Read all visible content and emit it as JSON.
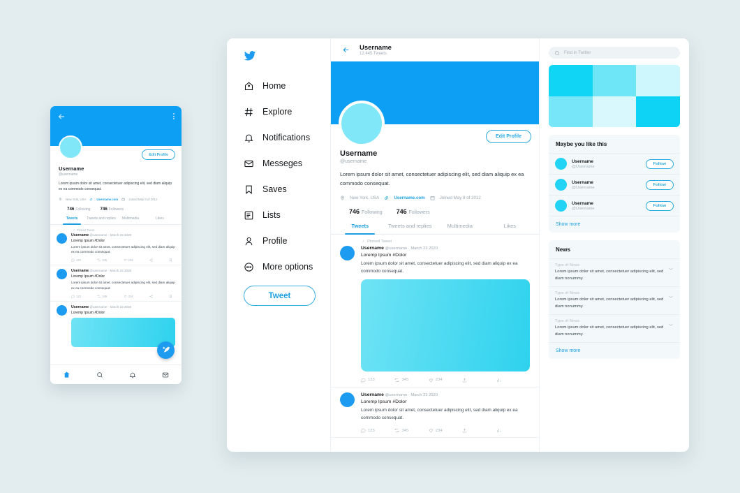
{
  "theme": {
    "background": "#e3ecee",
    "brand_blue": "#1d9bf0",
    "banner_blue": "#0d9ff4",
    "accent_cyan": "#23d3f5",
    "avatar_cyan": "#7fe7f7",
    "muted_text": "#9aa7b0"
  },
  "mobile": {
    "back_icon": "arrow-left-icon",
    "menu_icon": "more-vertical-icon",
    "edit_profile_label": "Edit Profile",
    "name": "Username",
    "handle": "@username",
    "bio": "Lorem ipsum dolor sit amet, consectetuer adipiscing elit, sed diam aliquip ex ea commodo consequat.",
    "meta": {
      "location": "New York, USA",
      "website": "Username.com",
      "joined": "Joined May 8 of 2012"
    },
    "stats": {
      "following_count": "746",
      "following_label": "Following",
      "followers_count": "746",
      "followers_label": "Followers"
    },
    "tabs": [
      "Tweets",
      "Tweets and replies",
      "Multimedia",
      "Likes"
    ],
    "active_tab": "Tweets",
    "pinned_label": "Pinned Tweet",
    "tweets": [
      {
        "pinned": true,
        "name": "Username",
        "meta": "@username · March 23 2020",
        "title": "Loremp Ipsum #Dolor",
        "text": "Lorem ipsum dolor sit amet, consectetuer adipiscing elit, sed diam aliquip ex ea commodo consequat.",
        "comments": "123",
        "retweets": "345",
        "likes": "234"
      },
      {
        "pinned": false,
        "name": "Username",
        "meta": "@username · March 23 2020",
        "title": "Loremp Ipsum #Dolor",
        "text": "Lorem ipsum dolor sit amet, consectetuer adipiscing elit, sed diam aliquip ex ea commodo consequat.",
        "comments": "123",
        "retweets": "345",
        "likes": "234"
      },
      {
        "pinned": false,
        "name": "Username",
        "meta": "@username · March 23 2020",
        "title": "Loremp Ipsum #Dolor",
        "text": "",
        "comments": "",
        "retweets": "",
        "likes": ""
      }
    ],
    "fab_icon": "compose-feather-icon",
    "nav": [
      "home-icon",
      "search-icon",
      "notifications-bell-icon",
      "messages-envelope-icon"
    ],
    "nav_active": "home-icon"
  },
  "sidebar": {
    "logo_icon": "twitter-bird-icon",
    "items": [
      {
        "label": "Home",
        "icon": "home-icon"
      },
      {
        "label": "Explore",
        "icon": "hashtag-icon"
      },
      {
        "label": "Notifications",
        "icon": "bell-icon"
      },
      {
        "label": "Messeges",
        "icon": "envelope-icon"
      },
      {
        "label": "Saves",
        "icon": "bookmark-icon"
      },
      {
        "label": "Lists",
        "icon": "list-icon"
      },
      {
        "label": "Profile",
        "icon": "person-icon"
      },
      {
        "label": "More options",
        "icon": "more-circle-icon"
      }
    ],
    "tweet_button": "Tweet"
  },
  "profile": {
    "back_icon": "arrow-left-icon",
    "header_title": "Username",
    "header_subtitle": "12.445 Tweets",
    "edit_profile_label": "Edit Profile",
    "name": "Username",
    "handle": "@username",
    "bio": "Lorem ipsum dolor sit amet, consectetuer adipiscing elit, sed diam aliquip ex ea commodo consequat.",
    "meta": {
      "location": "New York, USA",
      "website": "Username.com",
      "joined": "Joined May 8 of 2012"
    },
    "stats": {
      "following_count": "746",
      "following_label": "Following",
      "followers_count": "746",
      "followers_label": "Followers"
    },
    "tabs": [
      "Tweets",
      "Tweets and replies",
      "Multimedia",
      "Likes"
    ],
    "active_tab": "Tweets",
    "pinned_label": "Pinned Tweet",
    "tweets": [
      {
        "pinned": true,
        "name": "Username",
        "meta": "@username · March 23 2020",
        "title": "Loremp Ipsum #Dolor",
        "text": "Lorem ipsum dolor sit amet, consectetuer adipiscing elit, sed diam aliquip ex ea commodo consequat.",
        "has_image": true,
        "comments": "123",
        "retweets": "345",
        "likes": "234"
      },
      {
        "pinned": false,
        "name": "Username",
        "meta": "@username · March 23 2020",
        "title": "Loremp Ipsum #Dolor",
        "text": "Lorem ipsum dolor sit amet, consectetuer adipiscing elit, sed diam aliquip ex ea commodo consequat.",
        "has_image": false,
        "comments": "123",
        "retweets": "345",
        "likes": "234"
      }
    ]
  },
  "right": {
    "search_placeholder": "Find in Twitter",
    "search_icon": "search-icon",
    "grid_colors": [
      "#10d5f5",
      "#6fe5f8",
      "#cdf6fd",
      "#76e6f8",
      "#d8f8fd",
      "#0fd3f5"
    ],
    "suggestions_title": "Maybe you like this",
    "suggestions": [
      {
        "name": "Username",
        "handle": "@Username",
        "button": "Follow"
      },
      {
        "name": "Username",
        "handle": "@Username",
        "button": "Follow"
      },
      {
        "name": "Username",
        "handle": "@Username",
        "button": "Follow"
      }
    ],
    "suggestions_show_more": "Show more",
    "news_title": "News",
    "news": [
      {
        "type": "Type of News",
        "desc": "Lorem ipsum dolor sit amet, consectetuer adipiscing elit, sed diam nonummy."
      },
      {
        "type": "Type of News",
        "desc": "Lorem ipsum dolor sit amet, consectetuer adipiscing elit, sed diam nonummy."
      },
      {
        "type": "Type of News",
        "desc": "Lorem ipsum dolor sit amet, consectetuer adipiscing elit, sed diam nonummy."
      }
    ],
    "news_show_more": "Show more",
    "chevron_icon": "chevron-down-icon"
  }
}
